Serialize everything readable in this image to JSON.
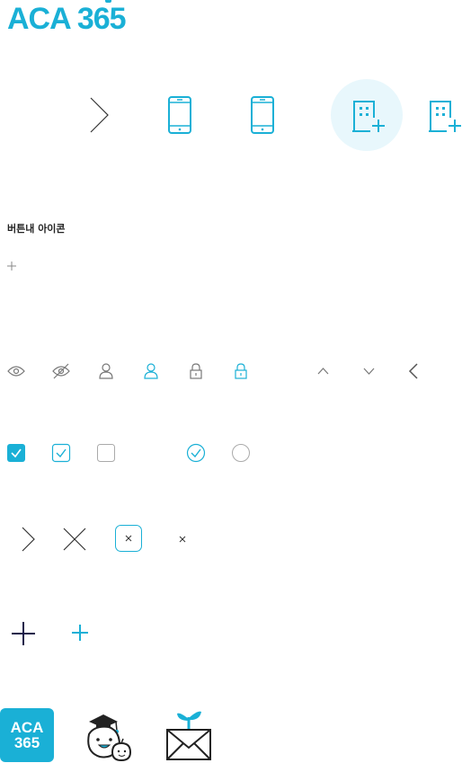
{
  "brand": {
    "logo_text": "ACA 365",
    "tile_line1": "ACA",
    "tile_line2": "365"
  },
  "sections": {
    "button_icons_title": "버튼내 아이콘"
  },
  "colors": {
    "accent": "#1ab0d6",
    "accent_light": "#e8f7fc",
    "dark": "#1a1a4a",
    "gray": "#888888"
  },
  "icons": {
    "row1": [
      "chevron-right-icon",
      "mobile-phone-icon",
      "mobile-phone-icon",
      "building-add-icon-active",
      "building-add-icon"
    ],
    "row_small": [
      "plus-icon"
    ],
    "row3": [
      "eye-icon",
      "eye-off-icon",
      "user-icon",
      "user-icon-active",
      "lock-icon",
      "lock-icon-active",
      "chevron-up-icon",
      "chevron-down-icon",
      "chevron-left-icon"
    ],
    "row4": [
      "checkbox-checked-filled-icon",
      "checkbox-checked-outline-icon",
      "checkbox-empty-icon",
      "radio-checked-icon",
      "radio-empty-icon"
    ],
    "row5": [
      "chevron-right-icon",
      "close-large-icon",
      "close-box-icon",
      "close-small-icon"
    ],
    "row6": [
      "plus-dark-icon",
      "plus-accent-icon"
    ],
    "row7": [
      "aca365-tile-logo",
      "graduate-character-icon",
      "envelope-sprout-icon"
    ]
  }
}
